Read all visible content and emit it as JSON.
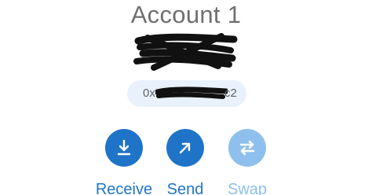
{
  "account": {
    "title": "Account 1"
  },
  "address": {
    "prefix": "0x",
    "suffix": "c2"
  },
  "actions": [
    {
      "label": "Receive",
      "icon": "download-arrow-icon",
      "color": "#1f74c8",
      "label_color": "#1f74c8"
    },
    {
      "label": "Send",
      "icon": "diagonal-arrow-icon",
      "color": "#1f74c8",
      "label_color": "#1f74c8"
    },
    {
      "label": "Swap",
      "icon": "swap-arrows-icon",
      "color": "#8fc0ed",
      "label_color": "#8fc0ed"
    }
  ]
}
